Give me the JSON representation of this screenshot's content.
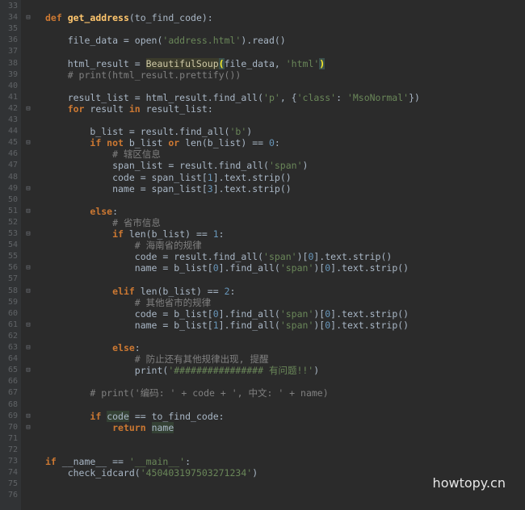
{
  "editor": {
    "lines": [
      {
        "n": "33",
        "fold": "",
        "segs": []
      },
      {
        "n": "34",
        "fold": "⊟",
        "segs": [
          {
            "c": "kw",
            "t": "def "
          },
          {
            "c": "fn",
            "t": "get_address"
          },
          {
            "c": "",
            "t": "(to_find_code):"
          }
        ]
      },
      {
        "n": "35",
        "fold": "",
        "segs": []
      },
      {
        "n": "36",
        "fold": "",
        "segs": [
          {
            "c": "",
            "t": "    file_data = open("
          },
          {
            "c": "str",
            "t": "'address.html'"
          },
          {
            "c": "",
            "t": ").read()"
          }
        ]
      },
      {
        "n": "37",
        "fold": "",
        "segs": []
      },
      {
        "n": "38",
        "fold": "",
        "segs": [
          {
            "c": "",
            "t": "    html_result = "
          },
          {
            "c": "hl-name",
            "t": "BeautifulSoup"
          },
          {
            "c": "hl-bracket",
            "t": "("
          },
          {
            "c": "",
            "t": "file_data, "
          },
          {
            "c": "str",
            "t": "'html'"
          },
          {
            "c": "hl-bracket",
            "t": ")"
          }
        ]
      },
      {
        "n": "39",
        "fold": "",
        "segs": [
          {
            "c": "cmt",
            "t": "    # print(html_result.prettify())"
          }
        ]
      },
      {
        "n": "40",
        "fold": "",
        "segs": []
      },
      {
        "n": "41",
        "fold": "",
        "segs": [
          {
            "c": "",
            "t": "    result_list = html_result.find_all("
          },
          {
            "c": "str",
            "t": "'p'"
          },
          {
            "c": "",
            "t": ", {"
          },
          {
            "c": "str",
            "t": "'class'"
          },
          {
            "c": "",
            "t": ": "
          },
          {
            "c": "str",
            "t": "'MsoNormal'"
          },
          {
            "c": "",
            "t": "})"
          }
        ]
      },
      {
        "n": "42",
        "fold": "⊟",
        "segs": [
          {
            "c": "",
            "t": "    "
          },
          {
            "c": "kw",
            "t": "for"
          },
          {
            "c": "",
            "t": " result "
          },
          {
            "c": "kw",
            "t": "in"
          },
          {
            "c": "",
            "t": " result_list:"
          }
        ]
      },
      {
        "n": "43",
        "fold": "",
        "segs": []
      },
      {
        "n": "44",
        "fold": "",
        "segs": [
          {
            "c": "",
            "t": "        b_list = result.find_all("
          },
          {
            "c": "str",
            "t": "'b'"
          },
          {
            "c": "",
            "t": ")"
          }
        ]
      },
      {
        "n": "45",
        "fold": "⊟",
        "segs": [
          {
            "c": "",
            "t": "        "
          },
          {
            "c": "kw",
            "t": "if not"
          },
          {
            "c": "",
            "t": " b_list "
          },
          {
            "c": "kw",
            "t": "or"
          },
          {
            "c": "",
            "t": " len(b_list) == "
          },
          {
            "c": "num",
            "t": "0"
          },
          {
            "c": "",
            "t": ":"
          }
        ]
      },
      {
        "n": "46",
        "fold": "",
        "segs": [
          {
            "c": "cmt",
            "t": "            # 辖区信息"
          }
        ]
      },
      {
        "n": "47",
        "fold": "",
        "segs": [
          {
            "c": "",
            "t": "            span_list = result.find_all("
          },
          {
            "c": "str",
            "t": "'span'"
          },
          {
            "c": "",
            "t": ")"
          }
        ]
      },
      {
        "n": "48",
        "fold": "",
        "segs": [
          {
            "c": "",
            "t": "            code = span_list["
          },
          {
            "c": "num",
            "t": "1"
          },
          {
            "c": "",
            "t": "].text.strip()"
          }
        ]
      },
      {
        "n": "49",
        "fold": "⊟",
        "segs": [
          {
            "c": "",
            "t": "            name = span_list["
          },
          {
            "c": "num",
            "t": "3"
          },
          {
            "c": "",
            "t": "].text.strip()"
          }
        ]
      },
      {
        "n": "50",
        "fold": "",
        "segs": []
      },
      {
        "n": "51",
        "fold": "⊟",
        "segs": [
          {
            "c": "",
            "t": "        "
          },
          {
            "c": "kw",
            "t": "else"
          },
          {
            "c": "",
            "t": ":"
          }
        ]
      },
      {
        "n": "52",
        "fold": "",
        "segs": [
          {
            "c": "cmt",
            "t": "            # 省市信息"
          }
        ]
      },
      {
        "n": "53",
        "fold": "⊟",
        "segs": [
          {
            "c": "",
            "t": "            "
          },
          {
            "c": "kw",
            "t": "if"
          },
          {
            "c": "",
            "t": " len(b_list) == "
          },
          {
            "c": "num",
            "t": "1"
          },
          {
            "c": "",
            "t": ":"
          }
        ]
      },
      {
        "n": "54",
        "fold": "",
        "segs": [
          {
            "c": "cmt",
            "t": "                # 海南省的规律"
          }
        ]
      },
      {
        "n": "55",
        "fold": "",
        "segs": [
          {
            "c": "",
            "t": "                code = result.find_all("
          },
          {
            "c": "str",
            "t": "'span'"
          },
          {
            "c": "",
            "t": ")["
          },
          {
            "c": "num",
            "t": "0"
          },
          {
            "c": "",
            "t": "].text.strip()"
          }
        ]
      },
      {
        "n": "56",
        "fold": "⊟",
        "segs": [
          {
            "c": "",
            "t": "                name = b_list["
          },
          {
            "c": "num",
            "t": "0"
          },
          {
            "c": "",
            "t": "].find_all("
          },
          {
            "c": "str",
            "t": "'span'"
          },
          {
            "c": "",
            "t": ")["
          },
          {
            "c": "num",
            "t": "0"
          },
          {
            "c": "",
            "t": "].text.strip()"
          }
        ]
      },
      {
        "n": "57",
        "fold": "",
        "segs": []
      },
      {
        "n": "58",
        "fold": "⊟",
        "segs": [
          {
            "c": "",
            "t": "            "
          },
          {
            "c": "kw",
            "t": "elif"
          },
          {
            "c": "",
            "t": " len(b_list) == "
          },
          {
            "c": "num",
            "t": "2"
          },
          {
            "c": "",
            "t": ":"
          }
        ]
      },
      {
        "n": "59",
        "fold": "",
        "segs": [
          {
            "c": "cmt",
            "t": "                # 其他省市的规律"
          }
        ]
      },
      {
        "n": "60",
        "fold": "",
        "segs": [
          {
            "c": "",
            "t": "                code = b_list["
          },
          {
            "c": "num",
            "t": "0"
          },
          {
            "c": "",
            "t": "].find_all("
          },
          {
            "c": "str",
            "t": "'span'"
          },
          {
            "c": "",
            "t": ")["
          },
          {
            "c": "num",
            "t": "0"
          },
          {
            "c": "",
            "t": "].text.strip()"
          }
        ]
      },
      {
        "n": "61",
        "fold": "⊟",
        "segs": [
          {
            "c": "",
            "t": "                name = b_list["
          },
          {
            "c": "num",
            "t": "1"
          },
          {
            "c": "",
            "t": "].find_all("
          },
          {
            "c": "str",
            "t": "'span'"
          },
          {
            "c": "",
            "t": ")["
          },
          {
            "c": "num",
            "t": "0"
          },
          {
            "c": "",
            "t": "].text.strip()"
          }
        ]
      },
      {
        "n": "62",
        "fold": "",
        "segs": []
      },
      {
        "n": "63",
        "fold": "⊟",
        "segs": [
          {
            "c": "",
            "t": "            "
          },
          {
            "c": "kw",
            "t": "else"
          },
          {
            "c": "",
            "t": ":"
          }
        ]
      },
      {
        "n": "64",
        "fold": "",
        "segs": [
          {
            "c": "cmt",
            "t": "                # 防止还有其他规律出现, 提醒"
          }
        ]
      },
      {
        "n": "65",
        "fold": "⊟",
        "segs": [
          {
            "c": "",
            "t": "                print("
          },
          {
            "c": "str",
            "t": "'################ 有问题!!'"
          },
          {
            "c": "",
            "t": ")"
          }
        ]
      },
      {
        "n": "66",
        "fold": "",
        "segs": []
      },
      {
        "n": "67",
        "fold": "",
        "segs": [
          {
            "c": "cmt",
            "t": "        # print('编码: ' + code + ', 中文: ' + name)"
          }
        ]
      },
      {
        "n": "68",
        "fold": "",
        "segs": []
      },
      {
        "n": "69",
        "fold": "⊟",
        "segs": [
          {
            "c": "",
            "t": "        "
          },
          {
            "c": "kw",
            "t": "if"
          },
          {
            "c": "",
            "t": " "
          },
          {
            "c": "hl-word",
            "t": "code"
          },
          {
            "c": "",
            "t": " == to_find_code:"
          }
        ]
      },
      {
        "n": "70",
        "fold": "⊟",
        "segs": [
          {
            "c": "",
            "t": "            "
          },
          {
            "c": "kw",
            "t": "return"
          },
          {
            "c": "",
            "t": " "
          },
          {
            "c": "hl-word",
            "t": "name"
          }
        ]
      },
      {
        "n": "71",
        "fold": "",
        "segs": []
      },
      {
        "n": "72",
        "fold": "",
        "segs": []
      },
      {
        "n": "73",
        "fold": "",
        "segs": [
          {
            "c": "kw",
            "t": "if"
          },
          {
            "c": "",
            "t": " __name__ == "
          },
          {
            "c": "str",
            "t": "'__main__'"
          },
          {
            "c": "",
            "t": ":"
          }
        ]
      },
      {
        "n": "74",
        "fold": "",
        "segs": [
          {
            "c": "",
            "t": "    check_idcard("
          },
          {
            "c": "str",
            "t": "'450403197503271234'"
          },
          {
            "c": "",
            "t": ")"
          }
        ]
      },
      {
        "n": "75",
        "fold": "",
        "segs": []
      },
      {
        "n": "76",
        "fold": "",
        "segs": []
      }
    ]
  },
  "watermark": {
    "text": "howtopy.cn"
  }
}
